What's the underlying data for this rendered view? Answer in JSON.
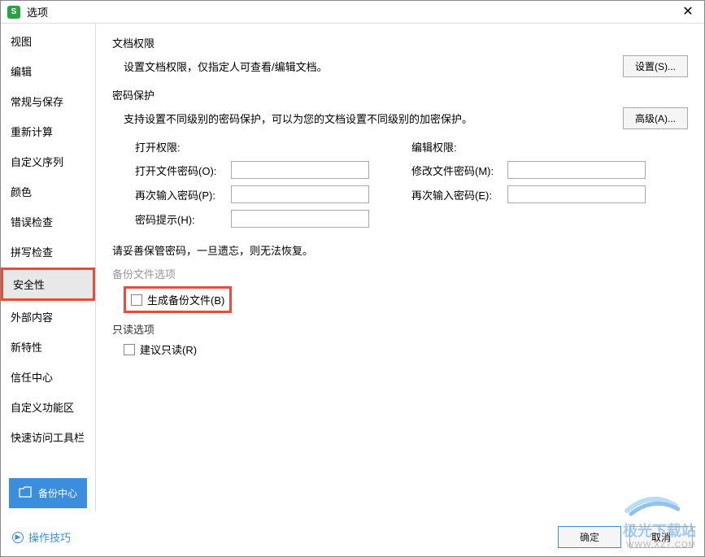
{
  "titlebar": {
    "title": "选项"
  },
  "sidebar": {
    "items": [
      "视图",
      "编辑",
      "常规与保存",
      "重新计算",
      "自定义序列",
      "颜色",
      "错误检查",
      "拼写检查",
      "安全性",
      "外部内容",
      "新特性",
      "信任中心",
      "自定义功能区",
      "快速访问工具栏"
    ],
    "backupCenter": "备份中心"
  },
  "main": {
    "docPerm": {
      "title": "文档权限",
      "desc": "设置文档权限，仅指定人可查看/编辑文档。",
      "btn": "设置(S)..."
    },
    "pwProtect": {
      "title": "密码保护",
      "desc": "支持设置不同级别的密码保护，可以为您的文档设置不同级别的加密保护。",
      "btn": "高级(A)..."
    },
    "openPerm": "打开权限:",
    "editPerm": "编辑权限:",
    "openPwd": "打开文件密码(O):",
    "modPwd": "修改文件密码(M):",
    "rePwdP": "再次输入密码(P):",
    "rePwdE": "再次输入密码(E):",
    "hint": "密码提示(H):",
    "warn": "请妥善保管密码，一旦遗忘，则无法恢复。",
    "backupOpt": {
      "title": "备份文件选项",
      "checkbox": "生成备份文件(B)"
    },
    "readOnly": {
      "title": "只读选项",
      "checkbox": "建议只读(R)"
    }
  },
  "footer": {
    "tips": "操作技巧",
    "ok": "确定",
    "cancel": "取消"
  },
  "watermark": {
    "main": "极光下载站",
    "sub": "WWW.XZ7.COM"
  }
}
